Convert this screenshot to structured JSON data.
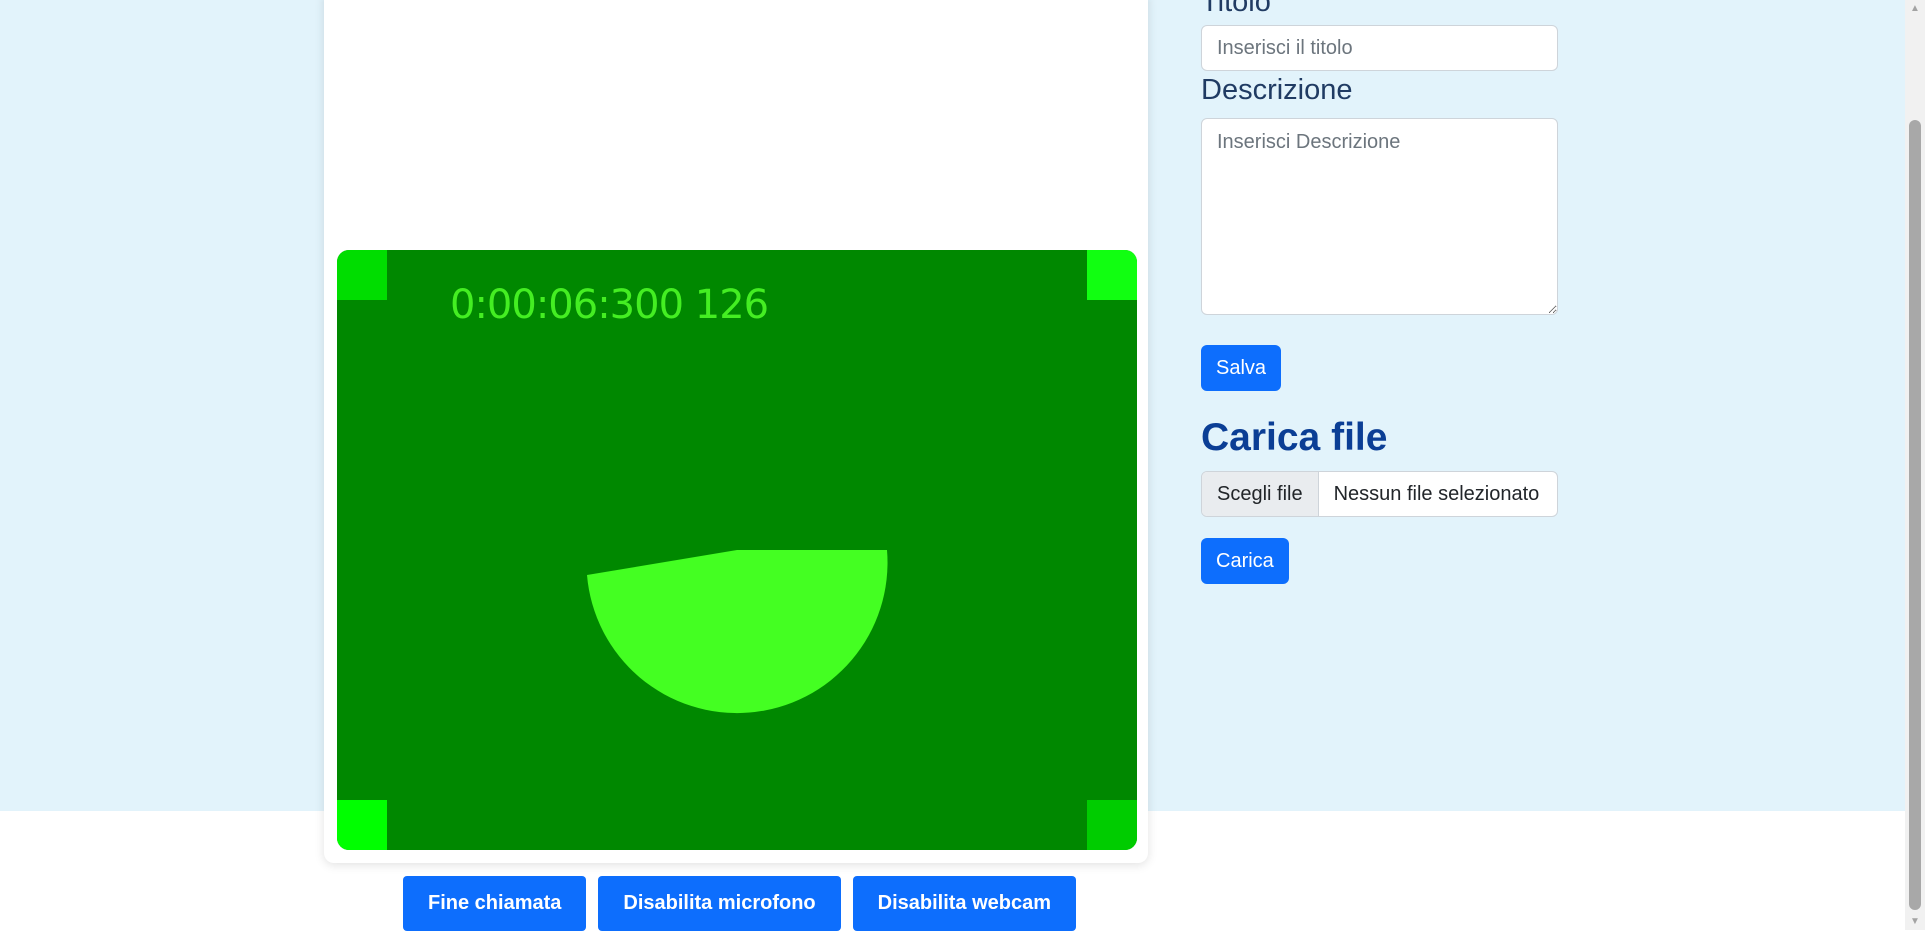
{
  "video": {
    "timestamp": "0:00:06:300 126"
  },
  "call_controls": {
    "end_call": "Fine chiamata",
    "disable_mic": "Disabilita microfono",
    "disable_webcam": "Disabilita webcam"
  },
  "form": {
    "title_label": "Titolo",
    "title_placeholder": "Inserisci il titolo",
    "description_label": "Descrizione",
    "description_placeholder": "Inserisci Descrizione",
    "save_label": "Salva"
  },
  "upload": {
    "heading": "Carica file",
    "choose_file_label": "Scegli file",
    "no_file_text": "Nessun file selezionato",
    "upload_label": "Carica"
  },
  "colors": {
    "page_bg": "#e2f3fb",
    "primary_button": "#0d6efd",
    "video_bg": "#008800",
    "heading": "#0b3e95"
  }
}
